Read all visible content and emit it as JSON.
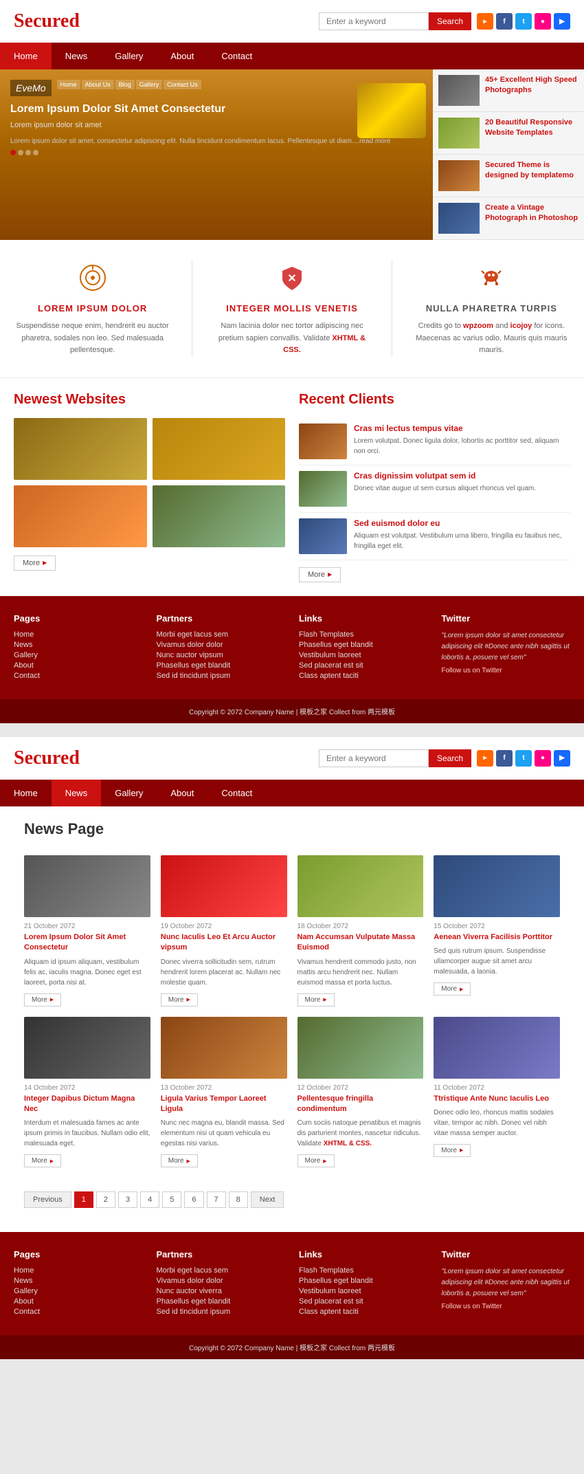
{
  "site": {
    "logo": "Secured",
    "search_placeholder": "Enter a keyword",
    "search_btn": "Search"
  },
  "social": [
    {
      "name": "rss",
      "label": "RSS"
    },
    {
      "name": "facebook",
      "label": "f"
    },
    {
      "name": "twitter",
      "label": "t"
    },
    {
      "name": "flickr",
      "label": "fl"
    },
    {
      "name": "youtube",
      "label": "y"
    }
  ],
  "nav": {
    "items": [
      "Home",
      "News",
      "Gallery",
      "About",
      "Contact"
    ],
    "active": 0
  },
  "nav2": {
    "items": [
      "Home",
      "News",
      "Gallery",
      "About",
      "Contact"
    ],
    "active": 1
  },
  "hero": {
    "logo_text": "EveMo",
    "mini_nav": [
      "Home",
      "About Us",
      "Blog",
      "Gallery",
      "Contact Us"
    ],
    "title": "Lorem Ipsum Dolor Sit Amet Consectetur",
    "subtitle": "Lorem ipsum dolor sit amet",
    "body_text": "Lorem ipsum dolor sit amet, consectetur adipiscing elit. Nulla tincidunt condimentum lacus. Pellentesque ut diam....read more",
    "side_items": [
      {
        "text": "45+ Excellent High Speed Photographs"
      },
      {
        "text": "20 Beautiful Responsive Website Templates"
      },
      {
        "text": "Secured Theme is designed by templatemo"
      },
      {
        "text": "Create a Vintage Photograph in Photoshop"
      }
    ]
  },
  "features": [
    {
      "title": "LOREM IPSUM DOLOR",
      "text": "Suspendisse neque enim, hendrerit eu auctor pharetra, sodales non leo. Sed malesuada pellentesque.",
      "icon": "target"
    },
    {
      "title": "INTEGER MOLLIS VENETIS",
      "text": "Nam lacinia dolor nec tortor adipiscing nec pretium sapien convallis. Validate XHTML & CSS.",
      "icon": "shield",
      "link_text": "XHTML & CSS."
    },
    {
      "title": "NULLA PHARETRA TURPIS",
      "text": "Credits go to wpzoom and icojoy for icons. Maecenas ac varius odio. Mauris quis mauris mauris.",
      "icon": "bug",
      "links": [
        "wpzoom",
        "icojoy"
      ]
    }
  ],
  "newest_websites": {
    "title": "Newest Websites",
    "more_label": "More"
  },
  "recent_clients": {
    "title": "Recent Clients",
    "more_label": "More",
    "items": [
      {
        "title": "Cras mi lectus tempus vitae",
        "text": "Lorem volutpat. Donec ligula dolor, lobortis ac porttitor sed, aliquam non orci."
      },
      {
        "title": "Cras dignissim volutpat sem id",
        "text": "Donec vitae augue ut sem cursus aliquet rhoncus vel quam."
      },
      {
        "title": "Sed euismod dolor eu",
        "text": "Aliquam est volutpat. Vestibulum urna libero, fringilla eu fauibus nec, fringilla eget elit."
      }
    ]
  },
  "footer1": {
    "pages": {
      "title": "Pages",
      "items": [
        "Home",
        "News",
        "Gallery",
        "About",
        "Contact"
      ]
    },
    "partners": {
      "title": "Partners",
      "items": [
        "Morbi eget lacus sem",
        "Vivamus dolor dolor",
        "Nunc auctor vipsum",
        "Phasellus eget blandit",
        "Sed id tincidunt ipsum"
      ]
    },
    "links": {
      "title": "Links",
      "items": [
        "Flash Templates",
        "Phasellus eget blandit",
        "Vestibulum laoreet",
        "Sed placerat est sit",
        "Class aptent taciti"
      ]
    },
    "twitter": {
      "title": "Twitter",
      "quote": "\"Lorem ipsum dolor sit amet consectetur adipiscing elit #Donec ante nibh sagittis ut lobortis a, posuere vel sem\"",
      "follow_label": "Follow us on Twitter"
    },
    "copyright": "Copyright © 2072 Company Name | 模板之家 Collect from 两元模板"
  },
  "news_page": {
    "title": "News Page",
    "articles": [
      {
        "date": "21 October 2072",
        "title": "Lorem Ipsum Dolor Sit Amet Consectetur",
        "text": "Aliquam id ipsum aliquam, vestibulum felis ac, iaculis magna. Donec eget est laoreet, porta nisi at.",
        "more": "More",
        "img_class": "nci1"
      },
      {
        "date": "19 October 2072",
        "title": "Nunc Iaculis Leo Et Arcu Auctor vipsum",
        "text": "Donec viverra sollicitudin sem, rutrum hendrerit lorem placerat ac. Nullam nec molestie quam.",
        "more": "More",
        "img_class": "nci2"
      },
      {
        "date": "18 October 2072",
        "title": "Nam Accumsan Vulputate Massa Euismod",
        "text": "Vivamus hendrerit commodo justo, non mattis arcu hendrerit nec. Nullam euismod massa et porta luctus.",
        "more": "More",
        "img_class": "nci3"
      },
      {
        "date": "15 October 2072",
        "title": "Aenean Viverra Facilisis Porttitor",
        "text": "Sed quis rutrum ipsum. Suspendisse ullamcorper augue sit amet arcu malesuada, a laonia.",
        "more": "More",
        "img_class": "nci4"
      },
      {
        "date": "14 October 2072",
        "title": "Integer Dapibus Dictum Magna Nec",
        "text": "Interdum et malesuada fames ac ante ipsum primis in faucibus. Nullam odio elit, malesuada eget.",
        "more": "More",
        "img_class": "nci5"
      },
      {
        "date": "13 October 2072",
        "title": "Ligula Varius Tempor Laoreet Ligula",
        "text": "Nunc nec magna eu, blandit massa. Sed elementum nisi ut quam vehicula eu egestas nisi varius.",
        "more": "More",
        "img_class": "nci6"
      },
      {
        "date": "12 October 2072",
        "title": "Pellentesque fringilla condimentum",
        "text": "Cum sociis natoque penatibus et magnis dis parturient montes, nascetur ridiculus. Validate XHTML & CSS.",
        "more": "More",
        "img_class": "nci7"
      },
      {
        "date": "11 October 2072",
        "title": "Ttristique Ante Nunc Iaculis Leo",
        "text": "Donec odio leo, rhoncus mattis sodales vitae, tempor ac nibh. Donec vel nibh vitae massa semper auctor.",
        "more": "More",
        "img_class": "nci8"
      }
    ],
    "pagination": {
      "prev": "Previous",
      "next": "Next",
      "pages": [
        "1",
        "2",
        "3",
        "4",
        "5",
        "6",
        "7",
        "8"
      ]
    }
  },
  "footer2": {
    "pages": {
      "title": "Pages",
      "items": [
        "Home",
        "News",
        "Gallery",
        "About",
        "Contact"
      ]
    },
    "partners": {
      "title": "Partners",
      "items": [
        "Morbi eget lacus sem",
        "Vivamus dolor dolor",
        "Nunc auctor viverra",
        "Phasellus eget blandit",
        "Sed id tincidunt ipsum"
      ]
    },
    "links": {
      "title": "Links",
      "items": [
        "Flash Templates",
        "Phasellus eget blandit",
        "Vestibulum laoreet",
        "Sed placerat est sit",
        "Class aptent taciti"
      ]
    },
    "twitter": {
      "title": "Twitter",
      "quote": "\"Lorem ipsum dolor sit amet consectetur adipiscing elit #Donec ante nibh sagittis ut lobortis a, posuere vel sem\"",
      "follow_label": "Follow us on Twitter"
    },
    "copyright": "Copyright © 2072 Company Name | 模板之家 Collect from 两元模板"
  }
}
